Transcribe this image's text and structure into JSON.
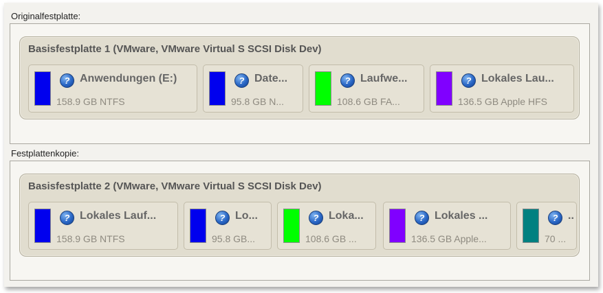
{
  "original": {
    "label": "Originalfestplatte:",
    "disk_title": "Basisfestplatte 1 (VMware, VMware Virtual S SCSI Disk Dev)",
    "partitions": [
      {
        "name": "Anwendungen (E:)",
        "info": "158.9 GB NTFS",
        "color": "#0000ee"
      },
      {
        "name": "Date...",
        "info": "95.8 GB N...",
        "color": "#0000ee"
      },
      {
        "name": "Laufwe...",
        "info": "108.6 GB FA...",
        "color": "#00ff00"
      },
      {
        "name": "Lokales Lau...",
        "info": "136.5 GB Apple HFS",
        "color": "#8000ff"
      }
    ]
  },
  "copy": {
    "label": "Festplattenkopie:",
    "disk_title": "Basisfestplatte 2 (VMware, VMware Virtual S SCSI Disk Dev)",
    "partitions": [
      {
        "name": "Lokales Lauf...",
        "info": "158.9 GB NTFS",
        "color": "#0000ee"
      },
      {
        "name": "Lo...",
        "info": "95.8 GB...",
        "color": "#0000ee"
      },
      {
        "name": "Loka...",
        "info": "108.6 GB ...",
        "color": "#00ff00"
      },
      {
        "name": "Lokales ...",
        "info": "136.5 GB Apple...",
        "color": "#8000ff"
      },
      {
        "name": "..",
        "info": "70 ...",
        "color": "#008080"
      }
    ]
  },
  "icons": {
    "help": "help-icon",
    "help_glyph": "?"
  }
}
